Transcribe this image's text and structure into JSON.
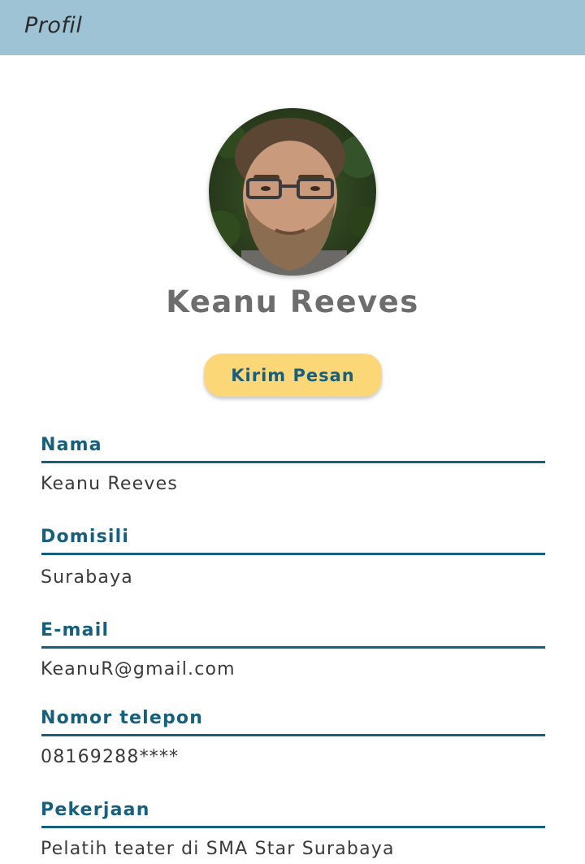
{
  "header": {
    "title": "Profil"
  },
  "profile": {
    "name": "Keanu Reeves",
    "avatar_icon": "profile-photo",
    "message_button_label": "Kirim Pesan"
  },
  "fields": [
    {
      "label": "Nama",
      "value": "Keanu Reeves"
    },
    {
      "label": "Domisili",
      "value": "Surabaya"
    },
    {
      "label": "E-mail",
      "value": "KeanuR@gmail.com"
    },
    {
      "label": "Nomor telepon",
      "value": "08169288****"
    },
    {
      "label": "Pekerjaan",
      "value": "Pelatih teater di SMA Star Surabaya"
    }
  ],
  "colors": {
    "header_bg": "#9dc3d4",
    "accent": "#17607d",
    "button_bg": "#fcd778",
    "name_text": "#6d6d6d"
  }
}
